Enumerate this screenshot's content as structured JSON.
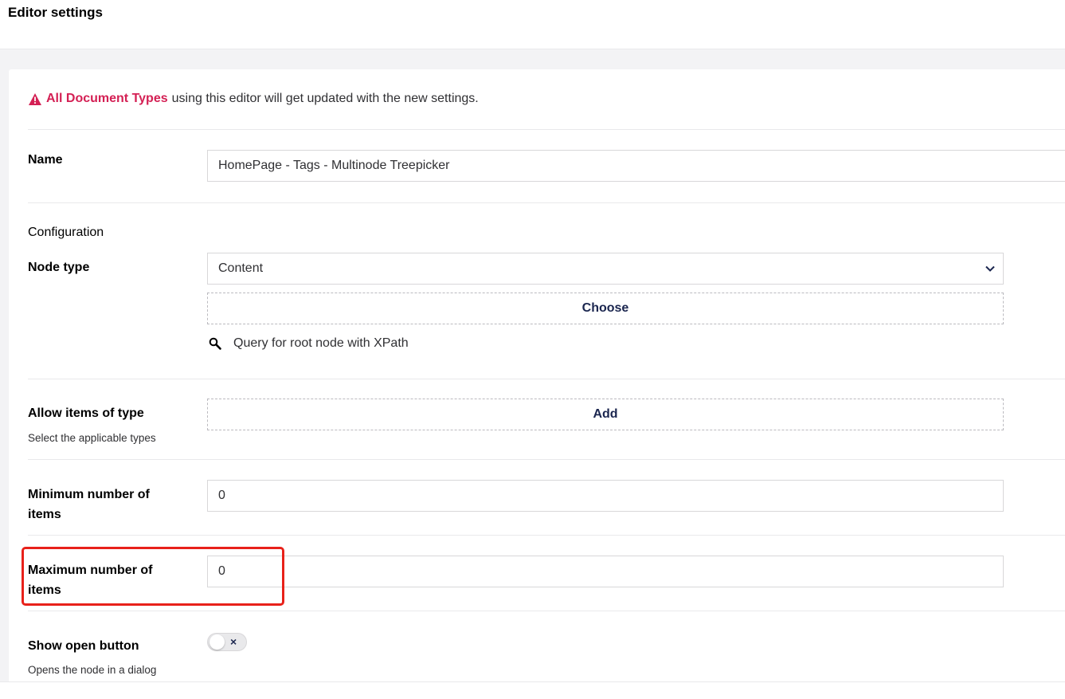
{
  "header": {
    "title": "Editor settings"
  },
  "warning": {
    "icon": "alert-triangle-icon",
    "link_text": "All Document Types",
    "message": "using this editor will get updated with the new settings."
  },
  "fields": {
    "name": {
      "label": "Name",
      "value": "HomePage - Tags - Multinode Treepicker"
    },
    "configuration": {
      "heading": "Configuration"
    },
    "node_type": {
      "label": "Node type",
      "selected": "Content",
      "choose_label": "Choose",
      "query_label": "Query for root node with XPath"
    },
    "allow_items": {
      "label": "Allow items of type",
      "description": "Select the applicable types",
      "add_label": "Add"
    },
    "min_items": {
      "label_line1": "Minimum number of",
      "label_line2": "items",
      "value": "0"
    },
    "max_items": {
      "label_line1": "Maximum number of",
      "label_line2": "items",
      "value": "0"
    },
    "show_open": {
      "label": "Show open button",
      "description": "Opens the node in a dialog",
      "toggle_state": "off",
      "toggle_symbol": "×"
    }
  },
  "colors": {
    "accent": "#d42054",
    "highlight": "#e8211a",
    "text": "#1b264f"
  }
}
